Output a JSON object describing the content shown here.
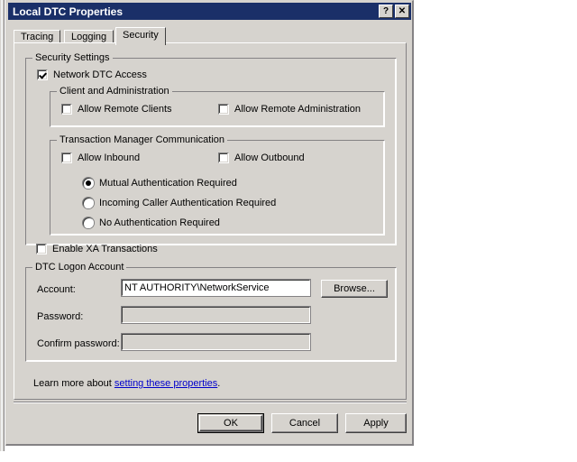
{
  "window": {
    "title": "Local DTC Properties",
    "help_button": "?",
    "close_button": "✕"
  },
  "tabs": [
    {
      "label": "Tracing",
      "active": false
    },
    {
      "label": "Logging",
      "active": false
    },
    {
      "label": "Security",
      "active": true
    }
  ],
  "security_settings": {
    "group_title": "Security Settings",
    "network_dtc_access": {
      "label": "Network DTC Access",
      "checked": true
    },
    "client_admin": {
      "group_title": "Client and Administration",
      "allow_remote_clients": {
        "label": "Allow Remote Clients",
        "checked": false
      },
      "allow_remote_administration": {
        "label": "Allow Remote Administration",
        "checked": false
      }
    },
    "transaction_manager": {
      "group_title": "Transaction Manager Communication",
      "allow_inbound": {
        "label": "Allow Inbound",
        "checked": false
      },
      "allow_outbound": {
        "label": "Allow Outbound",
        "checked": false
      },
      "auth_options": [
        {
          "label": "Mutual Authentication Required",
          "selected": true
        },
        {
          "label": "Incoming Caller Authentication Required",
          "selected": false
        },
        {
          "label": "No Authentication Required",
          "selected": false
        }
      ]
    },
    "enable_xa": {
      "label": "Enable XA Transactions",
      "checked": false
    }
  },
  "logon_account": {
    "group_title": "DTC Logon Account",
    "account_label": "Account:",
    "account_value": "NT AUTHORITY\\NetworkService",
    "browse_button": "Browse...",
    "password_label": "Password:",
    "password_value": "",
    "confirm_label": "Confirm password:",
    "confirm_value": ""
  },
  "footer": {
    "learn_prefix": "Learn more about ",
    "learn_link": "setting these properties",
    "learn_suffix": "."
  },
  "buttons": {
    "ok": "OK",
    "cancel": "Cancel",
    "apply": "Apply"
  },
  "colors": {
    "titlebar": "#1a2f68",
    "dialog_face": "#d6d3ce",
    "link": "#0000cc"
  }
}
